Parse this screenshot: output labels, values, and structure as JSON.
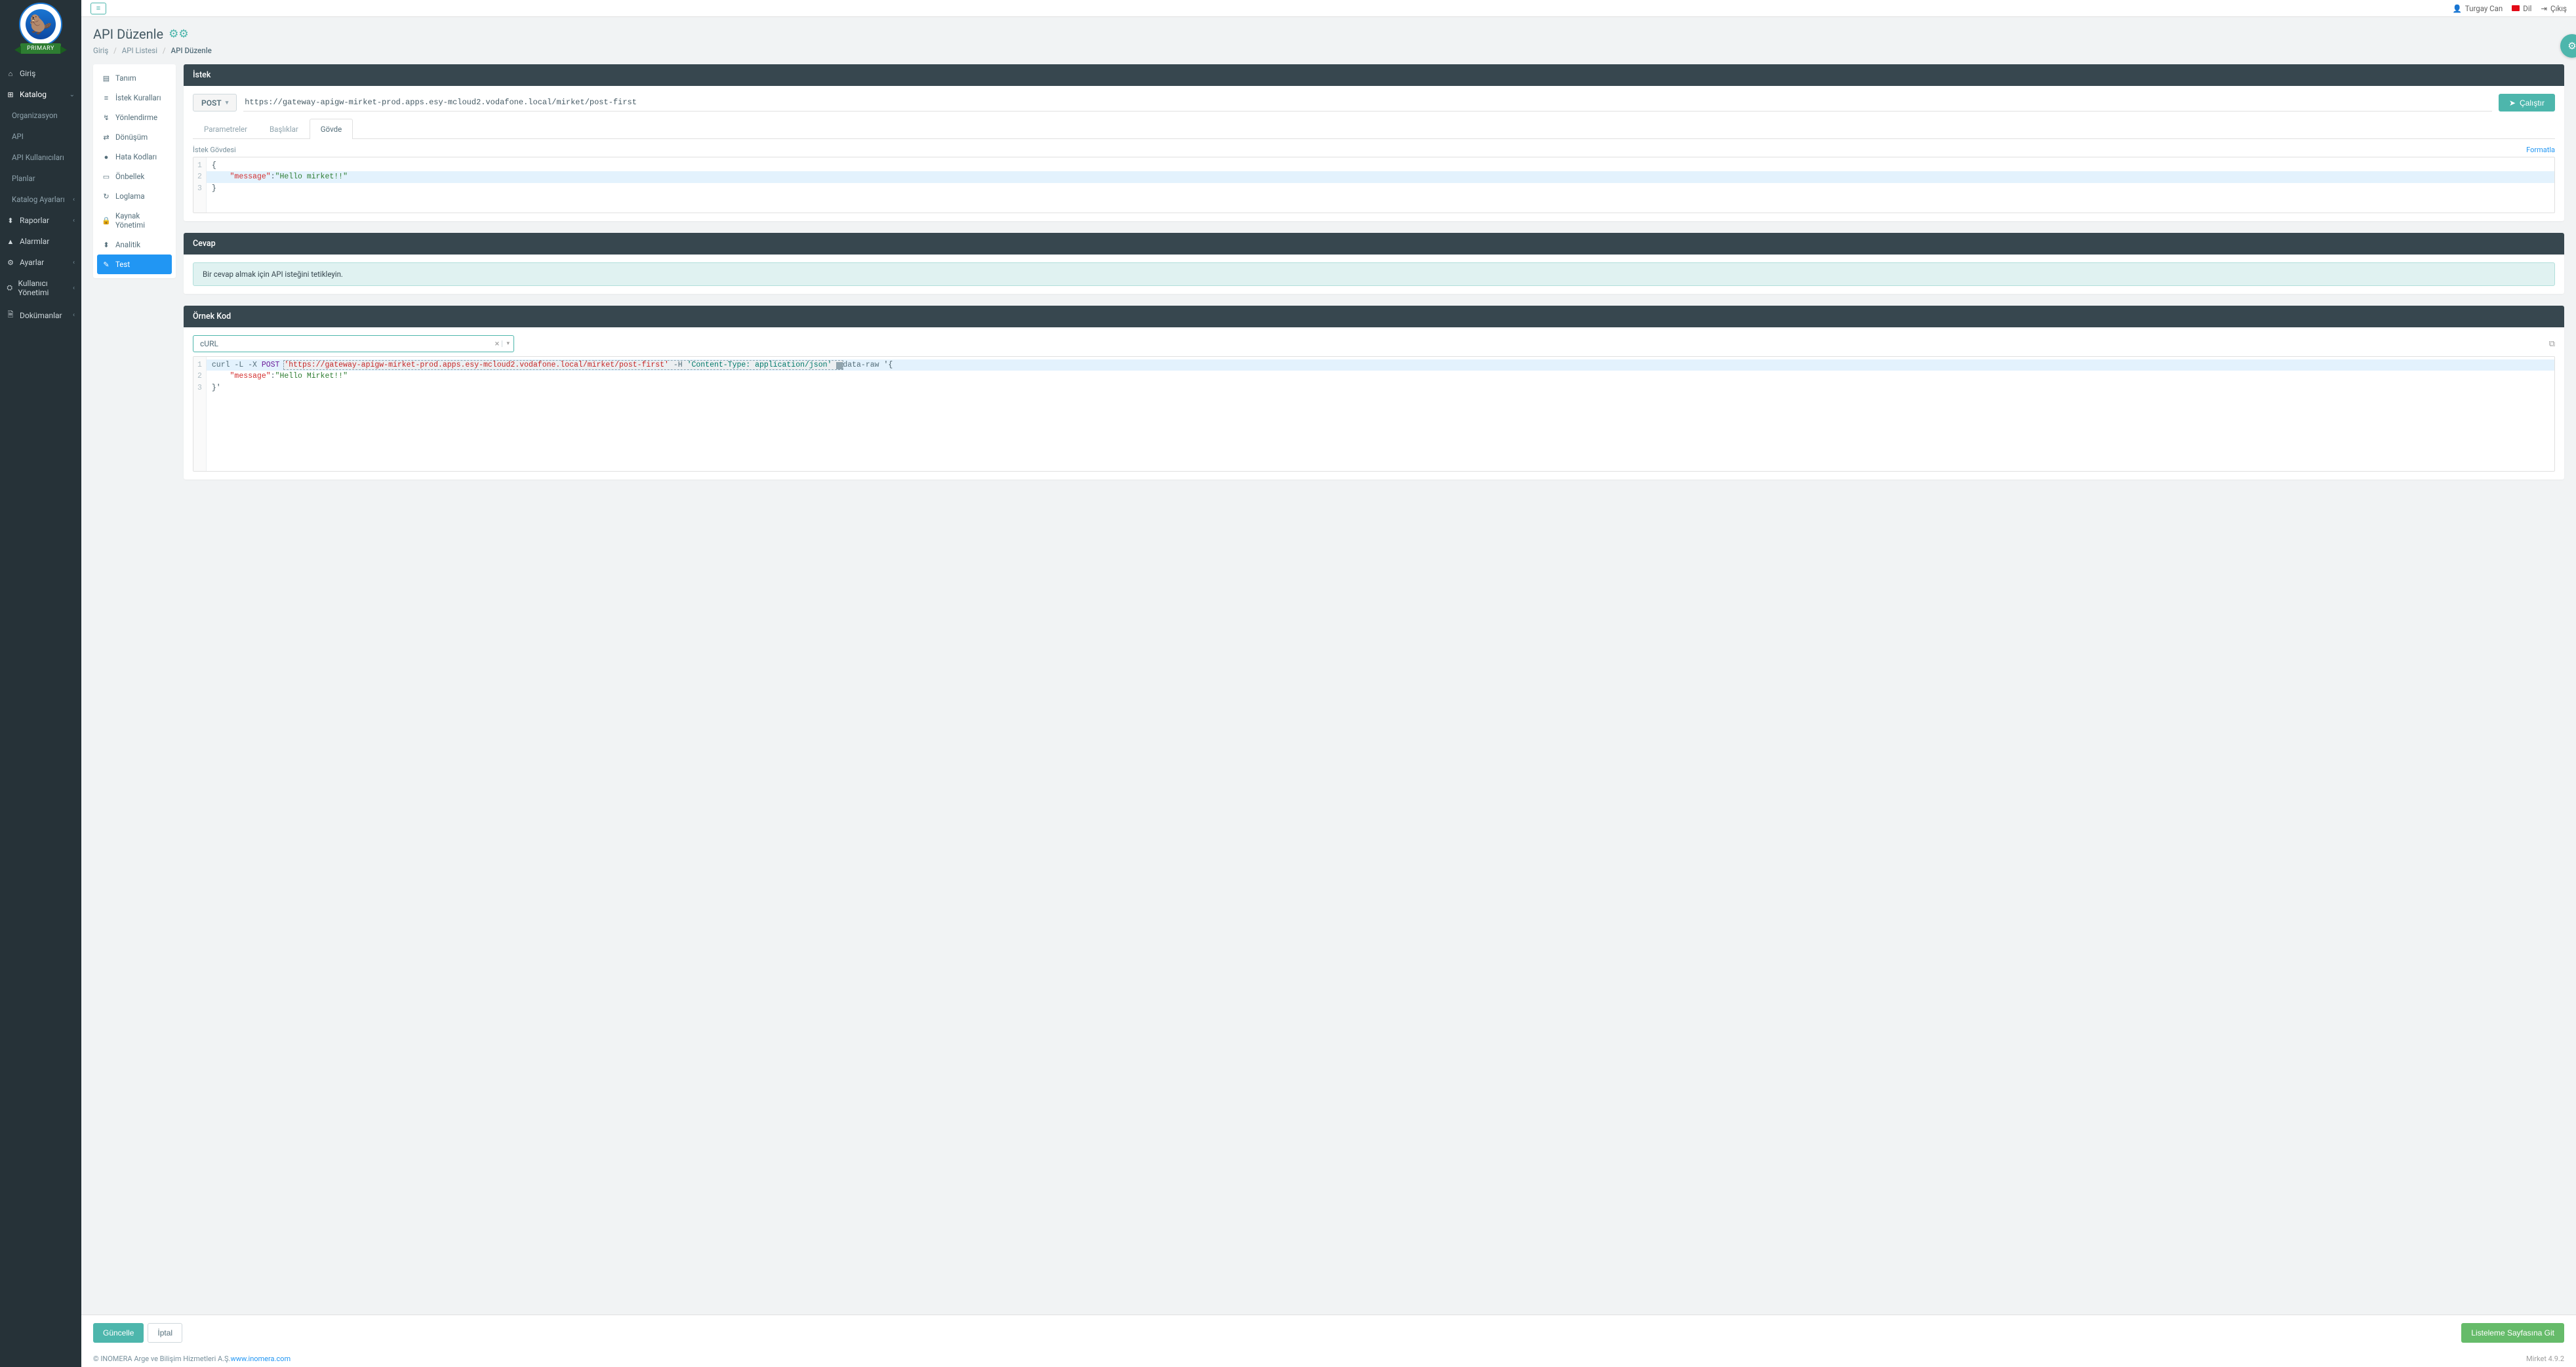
{
  "brand": {
    "badge": "PRIMARY"
  },
  "topbar": {
    "user": "Turgay Can",
    "lang": "Dil",
    "logout": "Çıkış"
  },
  "page": {
    "title": "API Düzenle",
    "breadcrumb": {
      "home": "Giriş",
      "list": "API Listesi",
      "current": "API Düzenle"
    }
  },
  "sidebar": {
    "items": [
      {
        "icon": "⌂",
        "label": "Giriş"
      },
      {
        "icon": "⊞",
        "label": "Katalog",
        "expandable": true,
        "active": true
      },
      {
        "sub": true,
        "label": "Organizasyon"
      },
      {
        "sub": true,
        "label": "API"
      },
      {
        "sub": true,
        "label": "API Kullanıcıları"
      },
      {
        "sub": true,
        "label": "Planlar"
      },
      {
        "sub": true,
        "label": "Katalog Ayarları",
        "chev": true
      },
      {
        "icon": "⬍",
        "label": "Raporlar",
        "chev": true
      },
      {
        "icon": "▲",
        "label": "Alarmlar"
      },
      {
        "icon": "⚙",
        "label": "Ayarlar",
        "chev": true
      },
      {
        "icon": "⛭",
        "label": "Kullanıcı Yönetimi",
        "chev": true
      },
      {
        "icon": "🗎",
        "label": "Dokümanlar",
        "chev": true
      }
    ]
  },
  "sideMenu": {
    "items": [
      {
        "icon": "▤",
        "label": "Tanım"
      },
      {
        "icon": "≡",
        "label": "İstek Kuralları"
      },
      {
        "icon": "↯",
        "label": "Yönlendirme"
      },
      {
        "icon": "⇄",
        "label": "Dönüşüm"
      },
      {
        "icon": "●",
        "label": "Hata Kodları"
      },
      {
        "icon": "▭",
        "label": "Önbellek"
      },
      {
        "icon": "↻",
        "label": "Loglama"
      },
      {
        "icon": "🔒",
        "label": "Kaynak Yönetimi"
      },
      {
        "icon": "⬍",
        "label": "Analitik"
      },
      {
        "icon": "✎",
        "label": "Test",
        "active": true
      }
    ]
  },
  "request": {
    "panel_title": "İstek",
    "method": "POST",
    "url": "https://gateway-apigw-mirket-prod.apps.esy-mcloud2.vodafone.local/mirket/post-first",
    "run": "Çalıştır",
    "tabs": {
      "params": "Parametreler",
      "headers": "Başlıklar",
      "body": "Gövde"
    },
    "body_label": "İstek Gövdesi",
    "format": "Formatla",
    "body_code": {
      "l1": "{",
      "l2_key": "\"message\"",
      "l2_sep": ":",
      "l2_val": "\"Hello mirket!!\"",
      "l3": "}"
    }
  },
  "response": {
    "panel_title": "Cevap",
    "placeholder": "Bir cevap almak için API isteğini tetikleyin."
  },
  "sample": {
    "panel_title": "Örnek Kod",
    "lang": "cURL",
    "code": {
      "l1_a": "curl -L -X ",
      "l1_method": "POST",
      "l1_url": "'https://gateway-apigw-mirket-prod.apps.esy-mcloud2.vodafone.local/mirket/post-first'",
      "l1_h": " -H ",
      "l1_header": "'Content-Type: application/json'",
      "l1_raw": "data-raw ",
      "l1_open": "'{",
      "l2_key": "\"message\"",
      "l2_sep": ":",
      "l2_val": "\"Hello Mirket!!\"",
      "l3": "}'"
    }
  },
  "actions": {
    "update": "Güncelle",
    "cancel": "İptal",
    "goto_list": "Listeleme Sayfasına Git"
  },
  "footer": {
    "copyright": "© INOMERA Arge ve Bilişim Hizmetleri A.Ş. ",
    "link": "www.inomera.com",
    "version": "Mirket 4.9.2"
  }
}
